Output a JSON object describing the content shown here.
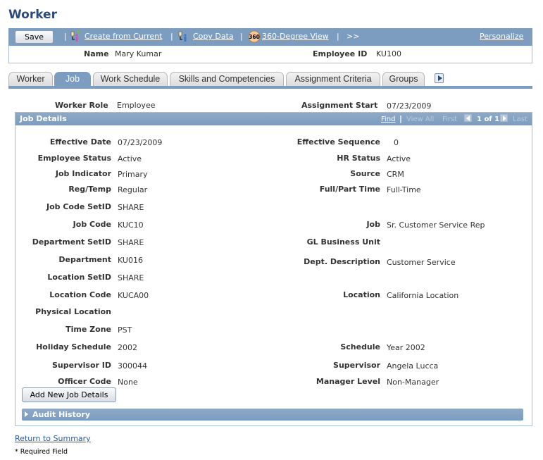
{
  "page": {
    "title": "Worker"
  },
  "toolbar": {
    "save_label": "Save",
    "separator": "|",
    "create_from_current": "Create from Current",
    "copy_data": "Copy Data",
    "view_360_badge": "360",
    "view_360": "360-Degree View",
    "more": ">>",
    "personalize": "Personalize"
  },
  "header": {
    "name_label": "Name",
    "name_value": "Mary Kumar",
    "employee_id_label": "Employee ID",
    "employee_id_value": "KU100"
  },
  "tabs": [
    {
      "label": "Worker",
      "active": false
    },
    {
      "label": "Job",
      "active": true
    },
    {
      "label": "Work Schedule",
      "active": false
    },
    {
      "label": "Skills and Competencies",
      "active": false
    },
    {
      "label": "Assignment Criteria",
      "active": false
    },
    {
      "label": "Groups",
      "active": false
    }
  ],
  "summary": {
    "worker_role_label": "Worker Role",
    "worker_role_value": "Employee",
    "assignment_start_label": "Assignment Start",
    "assignment_start_value": "07/23/2009"
  },
  "job_details": {
    "title": "Job Details",
    "nav": {
      "find": "Find",
      "separator": "|",
      "view_all": "View All",
      "first": "First",
      "count": "1 of 1",
      "last": "Last"
    },
    "left_fields": [
      {
        "label": "Effective Date",
        "value": "07/23/2009"
      },
      {
        "label": "Employee Status",
        "value": "Active"
      },
      {
        "label": "Job Indicator",
        "value": "Primary"
      },
      {
        "label": "Reg/Temp",
        "value": "Regular"
      },
      {
        "label": "Job Code SetID",
        "value": "SHARE"
      },
      {
        "label": "Job Code",
        "value": "KUC10"
      },
      {
        "label": "Department SetID",
        "value": "SHARE"
      },
      {
        "label": "Department",
        "value": "KU016"
      },
      {
        "label": "Location SetID",
        "value": "SHARE"
      },
      {
        "label": "Location Code",
        "value": "KUCA00"
      },
      {
        "label": "Physical Location",
        "value": ""
      },
      {
        "label": "Time Zone",
        "value": "PST"
      },
      {
        "label": "Holiday Schedule",
        "value": "2002"
      },
      {
        "label": "Supervisor ID",
        "value": "300044"
      },
      {
        "label": "Officer Code",
        "value": "None"
      }
    ],
    "right_fields": [
      {
        "label": "Effective Sequence",
        "value": "0"
      },
      {
        "label": "HR Status",
        "value": "Active"
      },
      {
        "label": "Source",
        "value": "CRM"
      },
      {
        "label": "Full/Part Time",
        "value": "Full-Time"
      },
      {
        "label": "Job",
        "value": "Sr. Customer Service Rep"
      },
      {
        "label": "GL Business Unit",
        "value": ""
      },
      {
        "label": "Dept. Description",
        "value": "Customer Service"
      },
      {
        "label": "Location",
        "value": "California Location"
      },
      {
        "label": "Schedule",
        "value": "Year 2002"
      },
      {
        "label": "Supervisor",
        "value": "Angela Lucca"
      },
      {
        "label": "Manager Level",
        "value": "Non-Manager"
      }
    ],
    "add_button": "Add New Job Details",
    "audit_history": "Audit History"
  },
  "footer": {
    "return_link": "Return to Summary",
    "required_note": "* Required Field"
  }
}
